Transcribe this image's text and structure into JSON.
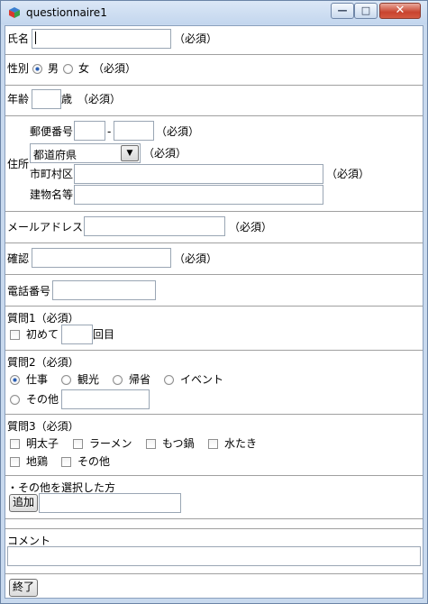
{
  "window": {
    "title": "questionnaire1",
    "controls": {
      "minimize": "—",
      "maximize": "□",
      "close": "✕"
    }
  },
  "name": {
    "label": "氏名",
    "value": "",
    "required": "（必須）"
  },
  "gender": {
    "label": "性別",
    "options": [
      "男",
      "女"
    ],
    "selected": "男",
    "required": "（必須）"
  },
  "age": {
    "label": "年齢",
    "value": "",
    "unit": "歳",
    "required": "（必須）"
  },
  "address": {
    "label": "住所",
    "postal_label": "郵便番号",
    "postal_first": "",
    "postal_sep": "-",
    "postal_second": "",
    "postal_required": "（必須）",
    "prefecture_value": "都道府県",
    "prefecture_required": "（必須）",
    "city_label": "市町村区",
    "city_value": "",
    "city_required": "（必須）",
    "building_label": "建物名等",
    "building_value": ""
  },
  "email": {
    "label": "メールアドレス",
    "value": "",
    "required": "（必須）"
  },
  "confirm": {
    "label": "確認",
    "value": "",
    "required": "（必須）"
  },
  "phone": {
    "label": "電話番号",
    "value": ""
  },
  "q1": {
    "label": "質問1（必須）",
    "first_label": "初めて",
    "count_value": "",
    "count_unit": "回目"
  },
  "q2": {
    "label": "質問2（必須）",
    "options": [
      "仕事",
      "観光",
      "帰省",
      "イベント",
      "その他"
    ],
    "selected": "仕事",
    "other_value": ""
  },
  "q3": {
    "label": "質問3（必須）",
    "options": [
      "明太子",
      "ラーメン",
      "もつ鍋",
      "水たき",
      "地鶏",
      "その他"
    ]
  },
  "other": {
    "label": "・その他を選択した方",
    "add_button": "追加",
    "value": ""
  },
  "comment": {
    "label": "コメント",
    "value": ""
  },
  "finish_button": "終了",
  "colors": {
    "radio_selected": "#2b5fb3",
    "close_button": "#c8432e"
  }
}
